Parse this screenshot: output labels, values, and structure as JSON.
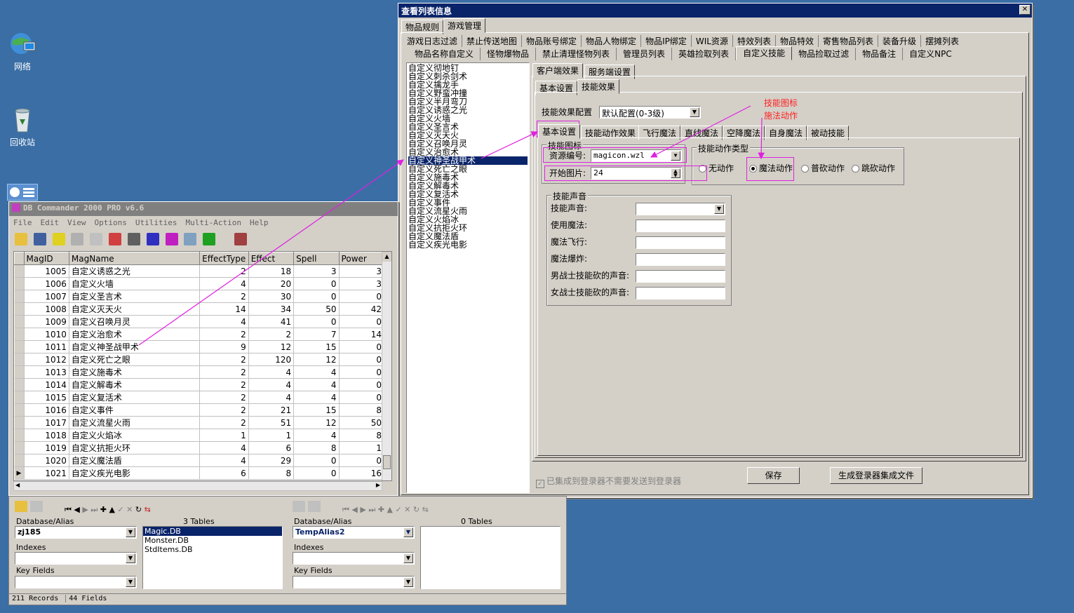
{
  "desktop": {
    "icons": [
      {
        "label": "网络"
      },
      {
        "label": "回收站"
      }
    ]
  },
  "viewer": {
    "title": "查看列表信息",
    "close": "✕",
    "top_tabs": [
      "物品规则",
      "游戏管理"
    ],
    "tab_row1": [
      "游戏日志过滤",
      "禁止传送地图",
      "物品账号绑定",
      "物品人物绑定",
      "物品IP绑定",
      "WIL资源",
      "特效列表",
      "物品特效",
      "寄售物品列表",
      "装备升级",
      "摆摊列表"
    ],
    "tab_row2": [
      "物品名称自定义",
      "怪物爆物品",
      "禁止清理怪物列表",
      "管理员列表",
      "英雄捡取列表",
      "自定义技能",
      "物品捡取过滤",
      "物品备注",
      "自定义NPC"
    ],
    "skill_list": [
      "自定义彻地钉",
      "自定义刺杀剑术",
      "自定义擒龙手",
      "自定义野蛮冲撞",
      "自定义半月弯刀",
      "自定义诱惑之光",
      "自定义火墙",
      "自定义圣言术",
      "自定义灭天火",
      "自定义召唤月灵",
      "自定义治愈术",
      "自定义神圣战甲术",
      "自定义死亡之眼",
      "自定义施毒术",
      "自定义解毒术",
      "自定义复活术",
      "自定义事件",
      "自定义流星火雨",
      "自定义火焰冰",
      "自定义抗拒火环",
      "自定义魔法盾",
      "自定义疾光电影"
    ],
    "selected_skill": "自定义神圣战甲术",
    "sub_tabs": [
      "客户端效果",
      "服务端设置"
    ],
    "sub_tabs2": [
      "基本设置",
      "技能效果"
    ],
    "effect_config_label": "技能效果配置",
    "effect_config_value": "默认配置(0-3级)",
    "inner_tabs": [
      "基本设置",
      "技能动作效果",
      "飞行魔法",
      "直线魔法",
      "空降魔法",
      "自身魔法",
      "被动技能"
    ],
    "skill_icon_group": "技能图标",
    "resource_label": "资源编号:",
    "resource_value": "magicon.wzl",
    "start_image_label": "开始图片:",
    "start_image_value": "24",
    "action_group": "技能动作类型",
    "actions": [
      "无动作",
      "魔法动作",
      "普砍动作",
      "跳砍动作"
    ],
    "selected_action": "魔法动作",
    "sound_group": "技能声音",
    "sound_fields": [
      "技能声音:",
      "使用魔法:",
      "魔法飞行:",
      "魔法爆炸:",
      "男战士技能砍的声音:",
      "女战士技能砍的声音:"
    ],
    "annotation_line1": "技能图标",
    "annotation_line2": "施法动作",
    "checkbox_label": "已集成到登录器不需要发送到登录器",
    "save_button": "保存",
    "generate_button": "生成登录器集成文件"
  },
  "dbc": {
    "title": "DB Commander 2000 PRO v6.6",
    "menu": [
      "File",
      "Edit",
      "View",
      "Options",
      "Utilities",
      "Multi-Action",
      "Help"
    ],
    "columns": [
      "MagID",
      "MagName",
      "EffectType",
      "Effect",
      "Spell",
      "Power"
    ],
    "rows": [
      [
        "1005",
        "自定义诱惑之光",
        "2",
        "18",
        "3",
        "3"
      ],
      [
        "1006",
        "自定义火墙",
        "4",
        "20",
        "0",
        "3"
      ],
      [
        "1007",
        "自定义圣言术",
        "2",
        "30",
        "0",
        "0"
      ],
      [
        "1008",
        "自定义灭天火",
        "14",
        "34",
        "50",
        "42"
      ],
      [
        "1009",
        "自定义召唤月灵",
        "4",
        "41",
        "0",
        "0"
      ],
      [
        "1010",
        "自定义治愈术",
        "2",
        "2",
        "7",
        "14"
      ],
      [
        "1011",
        "自定义神圣战甲术",
        "9",
        "12",
        "15",
        "0"
      ],
      [
        "1012",
        "自定义死亡之眼",
        "2",
        "120",
        "12",
        "0"
      ],
      [
        "1013",
        "自定义施毒术",
        "2",
        "4",
        "4",
        "0"
      ],
      [
        "1014",
        "自定义解毒术",
        "2",
        "4",
        "4",
        "0"
      ],
      [
        "1015",
        "自定义复活术",
        "2",
        "4",
        "4",
        "0"
      ],
      [
        "1016",
        "自定义事件",
        "2",
        "21",
        "15",
        "8"
      ],
      [
        "1017",
        "自定义流星火雨",
        "2",
        "51",
        "12",
        "50"
      ],
      [
        "1018",
        "自定义火焰冰",
        "1",
        "1",
        "4",
        "8"
      ],
      [
        "1019",
        "自定义抗拒火环",
        "4",
        "6",
        "8",
        "1"
      ],
      [
        "1020",
        "自定义魔法盾",
        "4",
        "29",
        "0",
        "0"
      ],
      [
        "1021",
        "自定义疾光电影",
        "6",
        "8",
        "0",
        "16"
      ]
    ],
    "left_panel": {
      "db_label": "Database/Alias",
      "db_value": "zj185",
      "tables_count": "3 Tables",
      "tables": [
        "Magic.DB",
        "Monster.DB",
        "StdItems.DB"
      ],
      "indexes_label": "Indexes",
      "keyfields_label": "Key Fields"
    },
    "right_panel": {
      "db_label": "Database/Alias",
      "db_value": "TempAlias2",
      "tables_count": "0 Tables",
      "indexes_label": "Indexes",
      "keyfields_label": "Key Fields"
    },
    "status_records": "211 Records",
    "status_fields": "44 Fields"
  },
  "colors": {
    "desktop": "#3a6ea5",
    "titlebar_active": "#0a246a",
    "highlight": "#e020e0",
    "annotation_red": "#ff2020"
  }
}
